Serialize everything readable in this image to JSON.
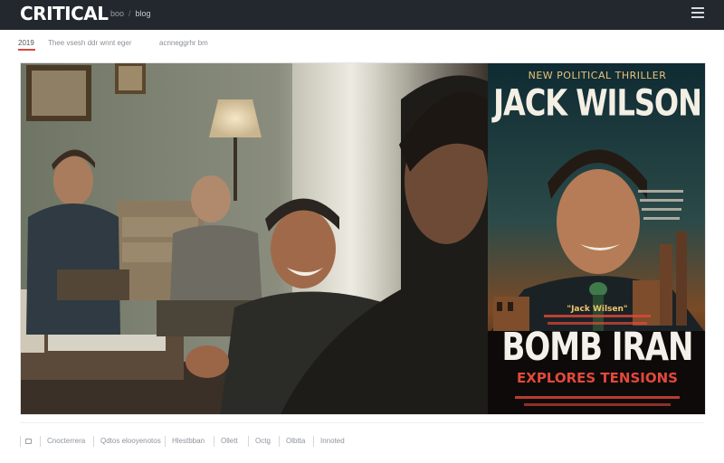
{
  "header": {
    "logo": "CRITICAL",
    "breadcrumb": [
      "boo",
      "blog"
    ],
    "menu_icon": "hamburger-icon"
  },
  "subnav": {
    "items": [
      {
        "label": "2019",
        "active": true
      },
      {
        "label": "Thee vsesh ddr wnnt eger",
        "active": false
      },
      {
        "label": "acnneggrhr bm",
        "active": false
      }
    ]
  },
  "hero": {
    "poster": {
      "tagline": "NEW POLITICAL THRILLER",
      "author": "JACK WILSON",
      "quote": "\"Jack Wilsen\"",
      "title": "BOMB IRAN",
      "subtitle": "EXPLORES TENSIONS"
    }
  },
  "footer_nav": {
    "home_icon": "home-icon",
    "items": [
      "Cnocterrera",
      "Qdtos elooyenotos",
      "Hlestbban",
      "Ollett",
      "Octg",
      "Olbtta",
      "Innoted"
    ]
  },
  "colors": {
    "header_bg": "#23272e",
    "accent": "#d8473d",
    "poster_gold": "#e9c27a",
    "poster_red": "#e2493a"
  }
}
